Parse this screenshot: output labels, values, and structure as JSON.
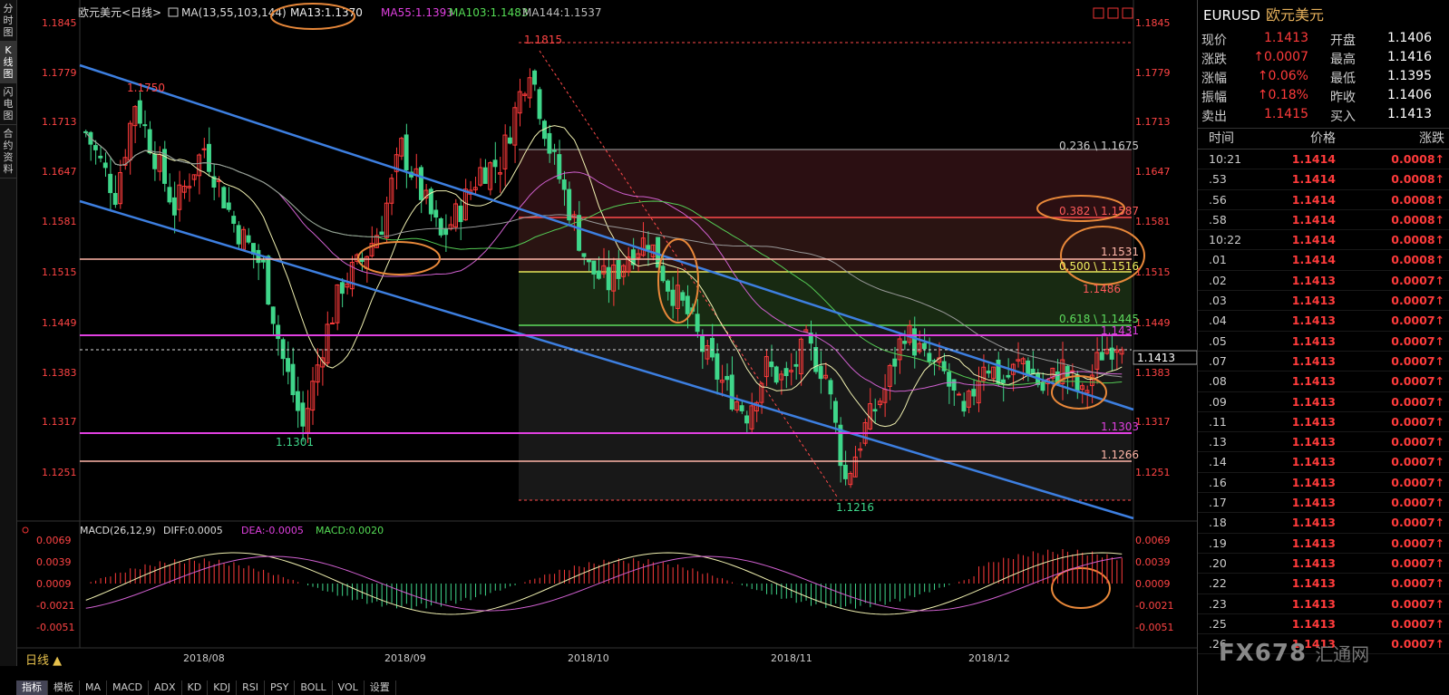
{
  "left_tabs": [
    "分时图",
    "K线图",
    "闪电图",
    "合约资料"
  ],
  "header": {
    "symbol_name": "欧元美元<日线>",
    "ma_params": "MA(13,55,103,144)",
    "ma13": "MA13:1.1370",
    "ma55": "MA55:1.1393",
    "ma103": "MA103:1.1483",
    "ma144": "MA144:1.1537"
  },
  "macd_header": {
    "params": "MACD(26,12,9)",
    "diff": "DIFF:0.0005",
    "dea": "DEA:-0.0005",
    "macd": "MACD:0.0020"
  },
  "price_axis": [
    "1.1845",
    "1.1779",
    "1.1713",
    "1.1647",
    "1.1581",
    "1.1515",
    "1.1449",
    "1.1383",
    "1.1317",
    "1.1251"
  ],
  "macd_axis": [
    "0.0069",
    "0.0039",
    "0.0009",
    "-0.0021",
    "-0.0051"
  ],
  "date_axis": [
    "2018/08",
    "2018/09",
    "2018/10",
    "2018/11",
    "2018/12"
  ],
  "current_price_label": "1.1413",
  "annotations": {
    "high_1750": "1.1750",
    "high_1815": "1.1815",
    "low_1301": "1.1301",
    "low_1216": "1.1216",
    "fib_236": "0.236 \\ 1.1675",
    "fib_382": "0.382 \\ 1.1587",
    "fib_500": "0.500 \\ 1.1516",
    "fib_618": "0.618 \\ 1.1445",
    "lvl_1531": "1.1531",
    "lvl_1486": "1.1486",
    "lvl_1431": "1.1431",
    "lvl_1303": "1.1303",
    "lvl_1266": "1.1266"
  },
  "period_label": "日线 ▲",
  "tools": [
    "指标",
    "模板",
    "MA",
    "MACD",
    "ADX",
    "KD",
    "KDJ",
    "RSI",
    "PSY",
    "BOLL",
    "VOL",
    "设置"
  ],
  "quote": {
    "symbol": "EURUSD",
    "name": "欧元美元",
    "rows": [
      {
        "l1": "现价",
        "v1": "1.1413",
        "c1": "red",
        "l2": "开盘",
        "v2": "1.1406"
      },
      {
        "l1": "涨跌",
        "v1": "↑0.0007",
        "c1": "red",
        "l2": "最高",
        "v2": "1.1416"
      },
      {
        "l1": "涨幅",
        "v1": "↑0.06%",
        "c1": "red",
        "l2": "最低",
        "v2": "1.1395"
      },
      {
        "l1": "振幅",
        "v1": "↑0.18%",
        "c1": "red",
        "l2": "昨收",
        "v2": "1.1406"
      },
      {
        "l1": "卖出",
        "v1": "1.1415",
        "c1": "red",
        "l2": "买入",
        "v2": "1.1413"
      }
    ],
    "tick_header": [
      "时间",
      "价格",
      "涨跌"
    ],
    "ticks": [
      {
        "t": "10:21",
        "p": "1.1414",
        "c": "0.0008↑"
      },
      {
        "t": ".53",
        "p": "1.1414",
        "c": "0.0008↑"
      },
      {
        "t": ".56",
        "p": "1.1414",
        "c": "0.0008↑"
      },
      {
        "t": ".58",
        "p": "1.1414",
        "c": "0.0008↑"
      },
      {
        "t": "10:22",
        "p": "1.1414",
        "c": "0.0008↑"
      },
      {
        "t": ".01",
        "p": "1.1414",
        "c": "0.0008↑"
      },
      {
        "t": ".02",
        "p": "1.1413",
        "c": "0.0007↑"
      },
      {
        "t": ".03",
        "p": "1.1413",
        "c": "0.0007↑"
      },
      {
        "t": ".04",
        "p": "1.1413",
        "c": "0.0007↑"
      },
      {
        "t": ".05",
        "p": "1.1413",
        "c": "0.0007↑"
      },
      {
        "t": ".07",
        "p": "1.1413",
        "c": "0.0007↑"
      },
      {
        "t": ".08",
        "p": "1.1413",
        "c": "0.0007↑"
      },
      {
        "t": ".09",
        "p": "1.1413",
        "c": "0.0007↑"
      },
      {
        "t": ".11",
        "p": "1.1413",
        "c": "0.0007↑"
      },
      {
        "t": ".13",
        "p": "1.1413",
        "c": "0.0007↑"
      },
      {
        "t": ".14",
        "p": "1.1413",
        "c": "0.0007↑"
      },
      {
        "t": ".16",
        "p": "1.1413",
        "c": "0.0007↑"
      },
      {
        "t": ".17",
        "p": "1.1413",
        "c": "0.0007↑"
      },
      {
        "t": ".18",
        "p": "1.1413",
        "c": "0.0007↑"
      },
      {
        "t": ".19",
        "p": "1.1413",
        "c": "0.0007↑"
      },
      {
        "t": ".20",
        "p": "1.1413",
        "c": "0.0007↑"
      },
      {
        "t": ".22",
        "p": "1.1413",
        "c": "0.0007↑"
      },
      {
        "t": ".23",
        "p": "1.1413",
        "c": "0.0007↑"
      },
      {
        "t": ".25",
        "p": "1.1413",
        "c": "0.0007↑"
      },
      {
        "t": ".26",
        "p": "1.1413",
        "c": "0.0007↑"
      }
    ]
  },
  "watermark": {
    "brand": "FX678",
    "cn": "汇通网"
  },
  "colors": {
    "up": "#ff3b3b",
    "down": "#3fd68a",
    "channel": "#3d7fe0",
    "magenta": "#e040e0",
    "salmon": "#ffb6a8"
  }
}
